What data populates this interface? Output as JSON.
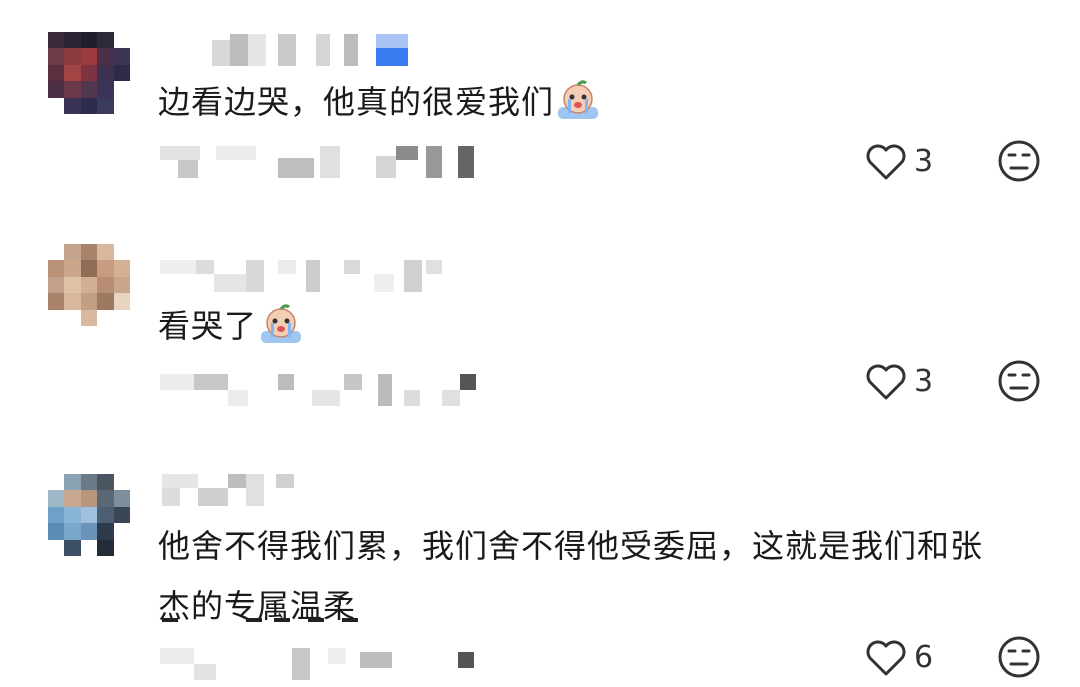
{
  "comments": [
    {
      "text": "边看边哭，他真的很爱我们",
      "emoji": "crying-face-emoji",
      "likes": "3"
    },
    {
      "text": "看哭了",
      "emoji": "crying-face-emoji",
      "likes": "3"
    },
    {
      "text_line1": "他舍不得我们累，我们舍不得他受委屈，这就是我们和张",
      "text_line2": "杰的专属温柔",
      "likes": "6"
    }
  ],
  "icons": {
    "like": "heart-outline-icon",
    "dislike": "neutral-face-icon"
  },
  "colors": {
    "text": "#1a1a1a",
    "icon": "#333333",
    "verified_badge": "#3a7bf0"
  }
}
